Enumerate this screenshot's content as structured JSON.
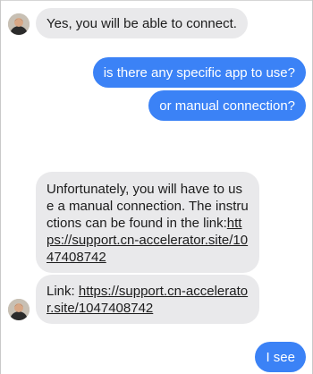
{
  "messages": [
    {
      "direction": "incoming",
      "text": "Yes, you will be able to connect."
    },
    {
      "direction": "outgoing",
      "text": "is there any specific app to use?"
    },
    {
      "direction": "outgoing",
      "text": "or manual connection?"
    },
    {
      "direction": "incoming",
      "text": "Unfortunately, you will have to use a manual connection. The instructions can be found in the link:",
      "link": "https://support.cn-accelerator.site/1047408742"
    },
    {
      "direction": "incoming",
      "text": "Link: ",
      "link": "https://support.cn-accelerator.site/1047408742"
    },
    {
      "direction": "outgoing",
      "text": "I see"
    }
  ],
  "colors": {
    "incoming_bubble": "#e9e9eb",
    "outgoing_bubble": "#3b82f6",
    "outgoing_text": "#ffffff"
  },
  "icons": {
    "avatar": "agent-avatar"
  }
}
